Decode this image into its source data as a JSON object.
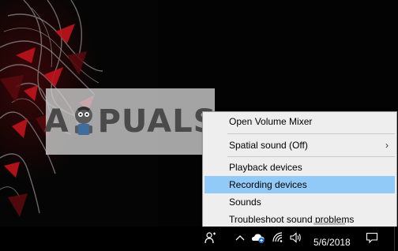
{
  "watermark": {
    "text_left": "A",
    "text_right": "PUALS"
  },
  "context_menu": {
    "items": [
      {
        "label": "Open Volume Mixer"
      },
      {
        "label": "Spatial sound (Off)",
        "submenu_arrow": "›"
      },
      {
        "label": "Playback devices"
      },
      {
        "label": "Recording devices",
        "selected": true
      },
      {
        "label": "Sounds"
      },
      {
        "label": "Troubleshoot sound problems"
      }
    ]
  },
  "taskbar": {
    "date": "5/6/2018",
    "icons": [
      "people-icon",
      "chevron-up-icon",
      "onedrive-icon",
      "wifi-icon",
      "speaker-icon",
      "action-center-icon"
    ]
  },
  "colors": {
    "menu_bg": "#eeeeee",
    "selected_bg": "#91c9f7",
    "taskbar_bg": "#000000",
    "wallpaper_accent": "#c0141c"
  }
}
